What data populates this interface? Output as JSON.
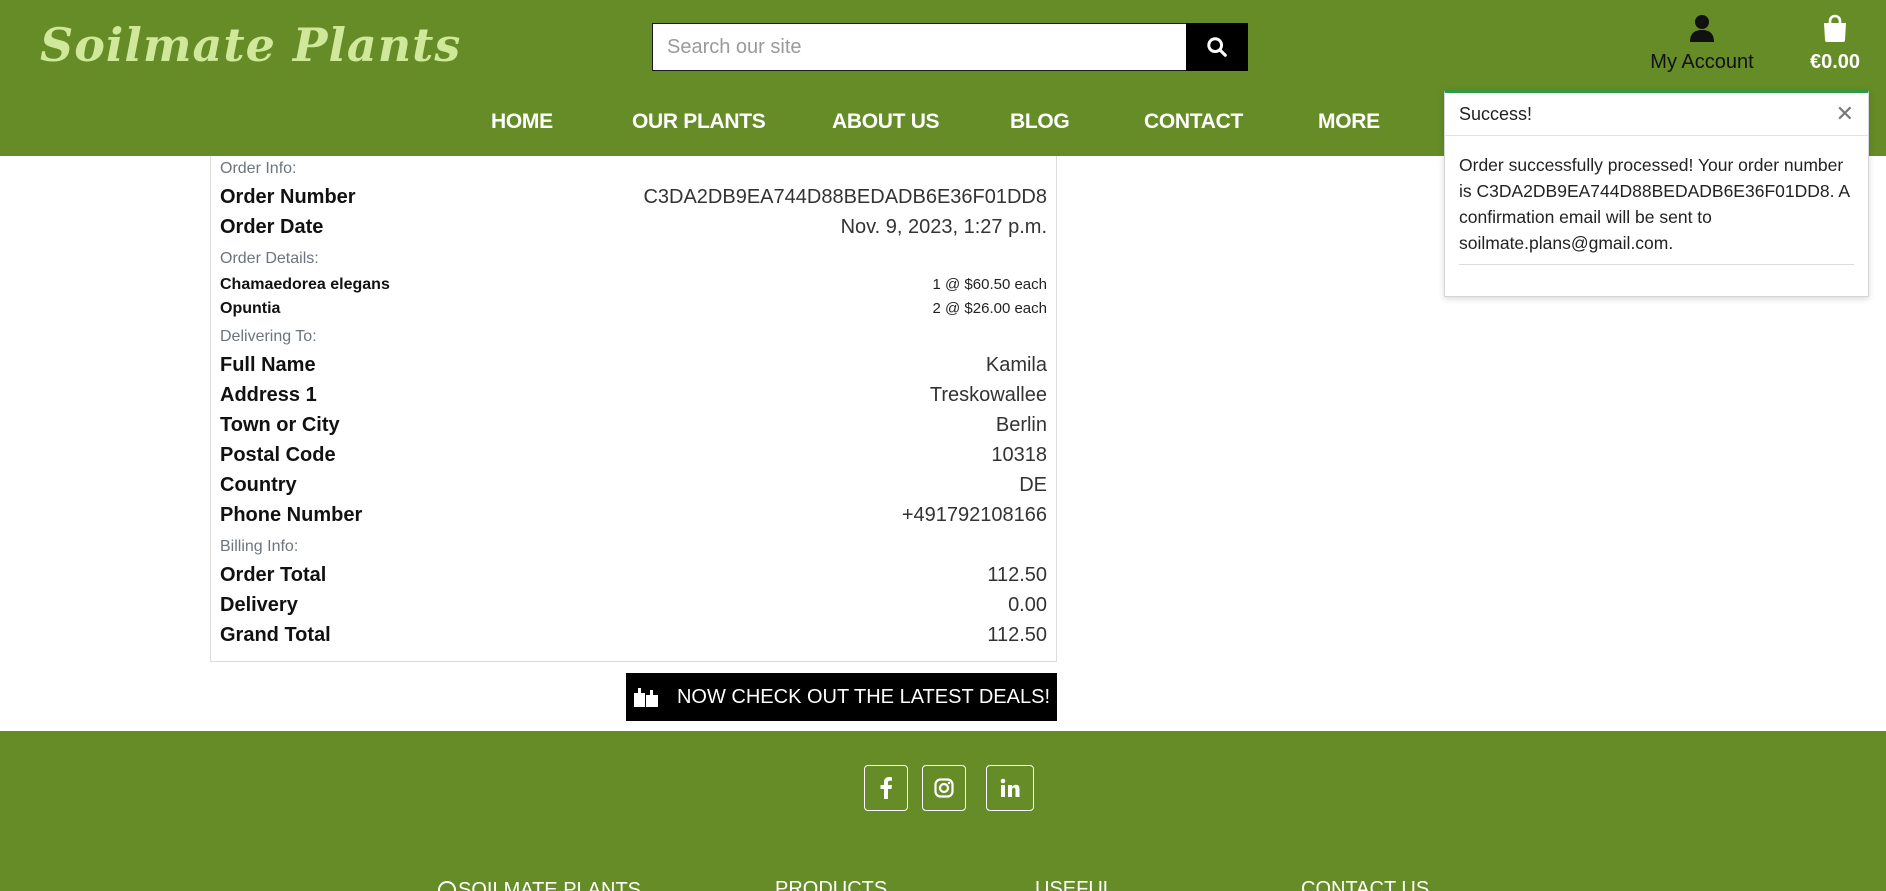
{
  "brand": {
    "name": "Soilmate Plants"
  },
  "search": {
    "placeholder": "Search our site"
  },
  "account": {
    "label": "My Account",
    "icon": "user-icon"
  },
  "bag": {
    "total": "€0.00",
    "icon": "shopping-bag-icon"
  },
  "nav": {
    "items": [
      "HOME",
      "OUR PLANTS",
      "ABOUT US",
      "BLOG",
      "CONTACT",
      "MORE"
    ]
  },
  "order": {
    "info_heading": "Order Info:",
    "number_label": "Order Number",
    "number_value": "C3DA2DB9EA744D88BEDADB6E36F01DD8",
    "date_label": "Order Date",
    "date_value": "Nov. 9, 2023, 1:27 p.m.",
    "details_heading": "Order Details:",
    "items": [
      {
        "name": "Chamaedorea elegans",
        "qty_price": "1 @ $60.50 each"
      },
      {
        "name": "Opuntia",
        "qty_price": "2 @ $26.00 each"
      }
    ],
    "delivery_heading": "Delivering To:",
    "delivery": [
      {
        "label": "Full Name",
        "value": "Kamila"
      },
      {
        "label": "Address 1",
        "value": "Treskowallee"
      },
      {
        "label": "Town or City",
        "value": "Berlin"
      },
      {
        "label": "Postal Code",
        "value": "10318"
      },
      {
        "label": "Country",
        "value": "DE"
      },
      {
        "label": "Phone Number",
        "value": "+491792108166"
      }
    ],
    "billing_heading": "Billing Info:",
    "billing": [
      {
        "label": "Order Total",
        "value": "112.50"
      },
      {
        "label": "Delivery",
        "value": "0.00"
      },
      {
        "label": "Grand Total",
        "value": "112.50"
      }
    ]
  },
  "deals_button": {
    "label": "NOW CHECK OUT THE LATEST DEALS!",
    "icon": "gift-icon"
  },
  "toast": {
    "title": "Success!",
    "message": "Order successfully processed! Your order number is C3DA2DB9EA744D88BEDADB6E36F01DD8. A confirmation email will be sent to soilmate.plans@gmail.com.",
    "close_icon": "close-icon"
  },
  "footer": {
    "social": [
      {
        "name": "facebook",
        "icon": "facebook-icon"
      },
      {
        "name": "instagram",
        "icon": "instagram-icon"
      },
      {
        "name": "linkedin",
        "icon": "linkedin-icon"
      }
    ],
    "columns": [
      "SOILMATE PLANTS",
      "PRODUCTS",
      "USEFUL",
      "CONTACT US"
    ]
  },
  "colors": {
    "header_green": "#658c27",
    "logo_green": "#cfe89a",
    "toast_accent": "#2f9a3f"
  }
}
